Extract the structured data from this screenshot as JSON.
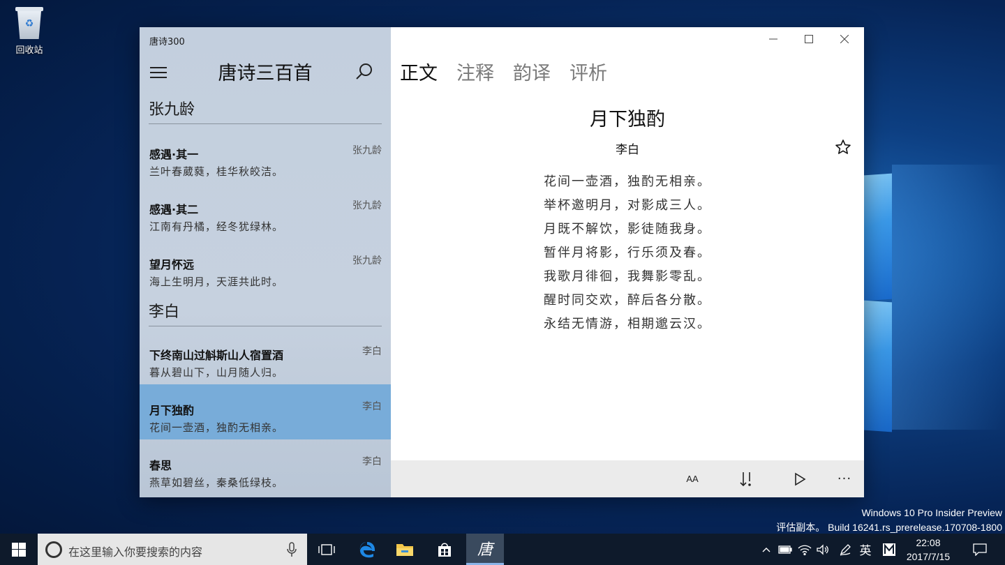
{
  "desktop": {
    "recycle_bin_label": "回收站",
    "watermark_line1": "Windows 10 Pro Insider Preview",
    "watermark_line2": "评估副本。 Build 16241.rs_prerelease.170708-1800"
  },
  "app": {
    "window_title": "唐诗300",
    "list_title": "唐诗三百首",
    "icons": {
      "menu": "hamburger-icon",
      "search": "search-icon",
      "star": "star-icon"
    }
  },
  "sidebar": {
    "sections": [
      {
        "poet": "张九龄",
        "poems": [
          {
            "title": "感遇·其一",
            "author": "张九龄",
            "first_line": "兰叶春葳蕤，桂华秋皎洁。",
            "selected": false
          },
          {
            "title": "感遇·其二",
            "author": "张九龄",
            "first_line": "江南有丹橘，经冬犹绿林。",
            "selected": false
          },
          {
            "title": "望月怀远",
            "author": "张九龄",
            "first_line": "海上生明月，天涯共此时。",
            "selected": false
          }
        ]
      },
      {
        "poet": "李白",
        "poems": [
          {
            "title": "下终南山过斛斯山人宿置酒",
            "author": "李白",
            "first_line": "暮从碧山下，山月随人归。",
            "selected": false
          },
          {
            "title": "月下独酌",
            "author": "李白",
            "first_line": "花间一壶酒，独酌无相亲。",
            "selected": true
          },
          {
            "title": "春思",
            "author": "李白",
            "first_line": "燕草如碧丝，秦桑低绿枝。",
            "selected": false
          }
        ]
      }
    ]
  },
  "detail": {
    "tabs": [
      {
        "label": "正文",
        "active": true
      },
      {
        "label": "注释",
        "active": false
      },
      {
        "label": "韵译",
        "active": false
      },
      {
        "label": "评析",
        "active": false
      }
    ],
    "poem_title": "月下独酌",
    "poem_author": "李白",
    "lines": [
      "花间一壶酒，独酌无相亲。",
      "举杯邀明月，对影成三人。",
      "月既不解饮，影徒随我身。",
      "暂伴月将影，行乐须及春。",
      "我歌月徘徊，我舞影零乱。",
      "醒时同交欢，醉后各分散。",
      "永结无情游，相期邈云汉。"
    ],
    "command_bar": {
      "font_size_label": "AA",
      "more_label": "···",
      "icons": [
        "font-size-icon",
        "sort-icon",
        "play-icon",
        "more-icon"
      ]
    }
  },
  "taskbar": {
    "search_placeholder": "在这里输入你要搜索的内容",
    "tang_app_label": "唐",
    "ime_label": "英",
    "time": "22:08",
    "date": "2017/7/15"
  },
  "colors": {
    "selected_item": "#78acd9",
    "left_pane": "#c3cfde",
    "taskbar": "#0e1a2b"
  }
}
